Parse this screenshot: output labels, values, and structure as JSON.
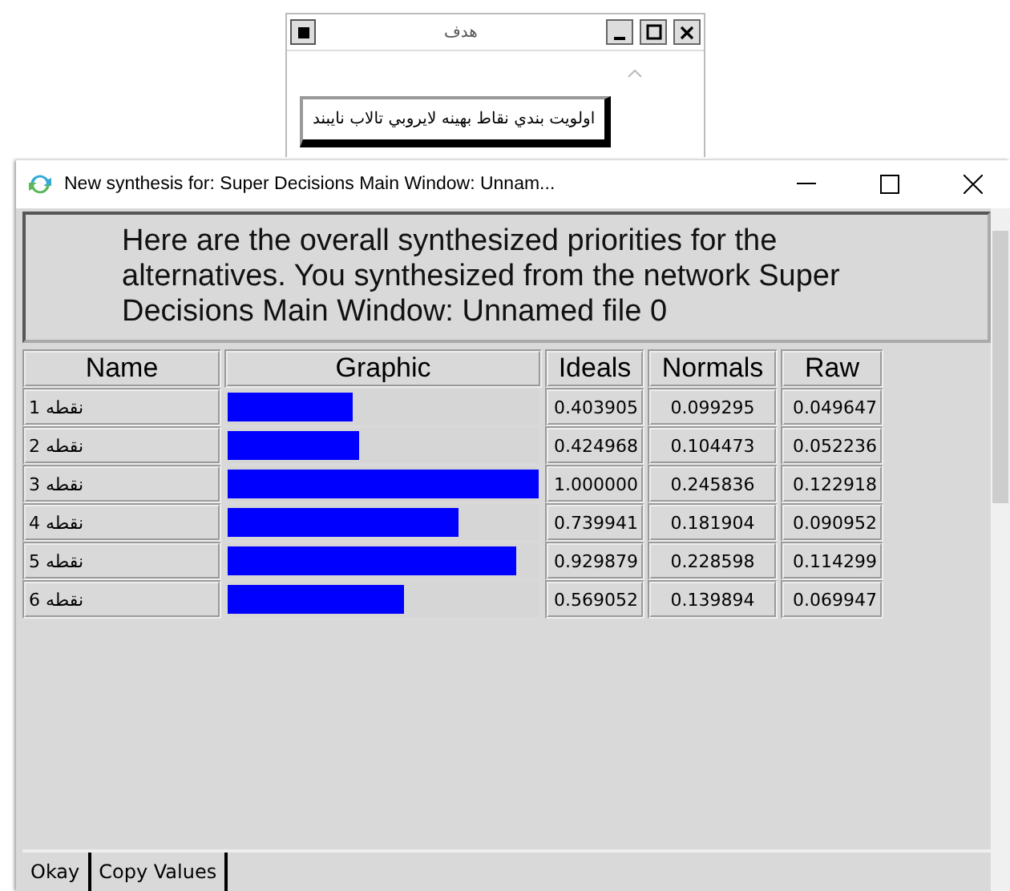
{
  "back_window": {
    "title": "هدف",
    "button": "اولويت بندي نقاط بهينه لايروبي تالاب نايبند"
  },
  "window": {
    "title": "New synthesis for: Super Decisions Main Window: Unnam..."
  },
  "message": "Here are the overall synthesized priorities for the alternatives.  You synthesized from the network Super Decisions Main Window: Unnamed file 0",
  "table": {
    "columns": [
      "Name",
      "Graphic",
      "Ideals",
      "Normals",
      "Raw"
    ],
    "rows": [
      {
        "name": "نقطه 1",
        "level": 0.403905,
        "ideals": "0.403905",
        "normals": "0.099295",
        "raw": "0.049647"
      },
      {
        "name": "نقطه 2",
        "level": 0.424968,
        "ideals": "0.424968",
        "normals": "0.104473",
        "raw": "0.052236"
      },
      {
        "name": "نقطه 3",
        "level": 1.0,
        "ideals": "1.000000",
        "normals": "0.245836",
        "raw": "0.122918"
      },
      {
        "name": "نقطه 4",
        "level": 0.739941,
        "ideals": "0.739941",
        "normals": "0.181904",
        "raw": "0.090952"
      },
      {
        "name": "نقطه 5",
        "level": 0.929879,
        "ideals": "0.929879",
        "normals": "0.228598",
        "raw": "0.114299"
      },
      {
        "name": "نقطه 6",
        "level": 0.569052,
        "ideals": "0.569052",
        "normals": "0.139894",
        "raw": "0.069947"
      }
    ]
  },
  "buttons": [
    "Okay",
    "Copy Values"
  ]
}
